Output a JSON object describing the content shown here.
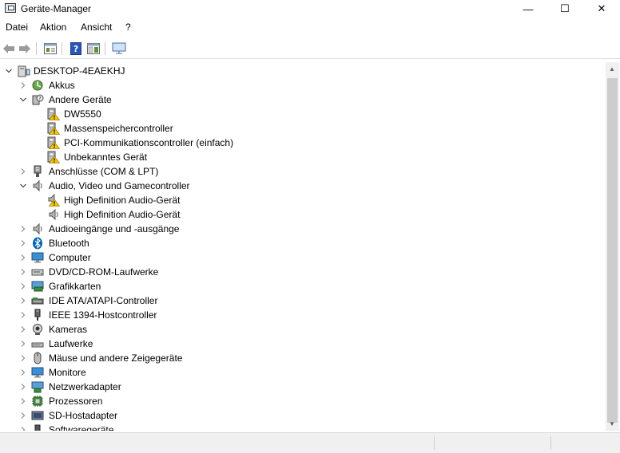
{
  "window": {
    "title": "Geräte-Manager",
    "buttons": {
      "minimize": "—",
      "maximize": "☐",
      "close": "✕"
    }
  },
  "menu": [
    {
      "label": "Datei"
    },
    {
      "label": "Aktion"
    },
    {
      "label": "Ansicht"
    },
    {
      "label": "?"
    }
  ],
  "toolbar": {
    "icons": [
      "back-arrow-icon",
      "forward-arrow-icon",
      "properties-grid-icon",
      "help-icon",
      "view-grid-icon",
      "monitor-scan-icon"
    ]
  },
  "tree": [
    {
      "label": "DESKTOP-4EAEKHJ",
      "level": 0,
      "state": "expanded",
      "icon": "computer-root-icon"
    },
    {
      "label": "Akkus",
      "level": 1,
      "state": "collapsed",
      "icon": "battery-icon"
    },
    {
      "label": "Andere Geräte",
      "level": 1,
      "state": "expanded",
      "icon": "unknown-device-icon"
    },
    {
      "label": "DW5550",
      "level": 2,
      "state": "none",
      "icon": "warning-device-icon"
    },
    {
      "label": "Massenspeichercontroller",
      "level": 2,
      "state": "none",
      "icon": "warning-device-icon"
    },
    {
      "label": "PCI-Kommunikationscontroller (einfach)",
      "level": 2,
      "state": "none",
      "icon": "warning-device-icon"
    },
    {
      "label": "Unbekanntes Gerät",
      "level": 2,
      "state": "none",
      "icon": "warning-device-icon"
    },
    {
      "label": "Anschlüsse (COM & LPT)",
      "level": 1,
      "state": "collapsed",
      "icon": "port-icon"
    },
    {
      "label": "Audio, Video und Gamecontroller",
      "level": 1,
      "state": "expanded",
      "icon": "speaker-icon"
    },
    {
      "label": "High Definition Audio-Gerät",
      "level": 2,
      "state": "none",
      "icon": "speaker-warning-icon"
    },
    {
      "label": "High Definition Audio-Gerät",
      "level": 2,
      "state": "none",
      "icon": "speaker-icon"
    },
    {
      "label": "Audioeingänge und -ausgänge",
      "level": 1,
      "state": "collapsed",
      "icon": "speaker-icon"
    },
    {
      "label": "Bluetooth",
      "level": 1,
      "state": "collapsed",
      "icon": "bluetooth-icon"
    },
    {
      "label": "Computer",
      "level": 1,
      "state": "collapsed",
      "icon": "monitor-icon"
    },
    {
      "label": "DVD/CD-ROM-Laufwerke",
      "level": 1,
      "state": "collapsed",
      "icon": "disc-drive-icon"
    },
    {
      "label": "Grafikkarten",
      "level": 1,
      "state": "collapsed",
      "icon": "display-adapter-icon"
    },
    {
      "label": "IDE ATA/ATAPI-Controller",
      "level": 1,
      "state": "collapsed",
      "icon": "ide-controller-icon"
    },
    {
      "label": "IEEE 1394-Hostcontroller",
      "level": 1,
      "state": "collapsed",
      "icon": "plug-icon"
    },
    {
      "label": "Kameras",
      "level": 1,
      "state": "collapsed",
      "icon": "camera-icon"
    },
    {
      "label": "Laufwerke",
      "level": 1,
      "state": "collapsed",
      "icon": "disk-drive-icon"
    },
    {
      "label": "Mäuse und andere Zeigegeräte",
      "level": 1,
      "state": "collapsed",
      "icon": "mouse-icon"
    },
    {
      "label": "Monitore",
      "level": 1,
      "state": "collapsed",
      "icon": "monitor-icon"
    },
    {
      "label": "Netzwerkadapter",
      "level": 1,
      "state": "collapsed",
      "icon": "network-adapter-icon"
    },
    {
      "label": "Prozessoren",
      "level": 1,
      "state": "collapsed",
      "icon": "processor-icon"
    },
    {
      "label": "SD-Hostadapter",
      "level": 1,
      "state": "collapsed",
      "icon": "sd-host-icon"
    },
    {
      "label": "Softwaregeräte",
      "level": 1,
      "state": "collapsed",
      "icon": "software-device-icon"
    }
  ],
  "colors": {
    "warning": "#f5c400",
    "accent": "#0063b1",
    "window_bg": "#ffffff",
    "statusbar": "#f0f0f0"
  }
}
